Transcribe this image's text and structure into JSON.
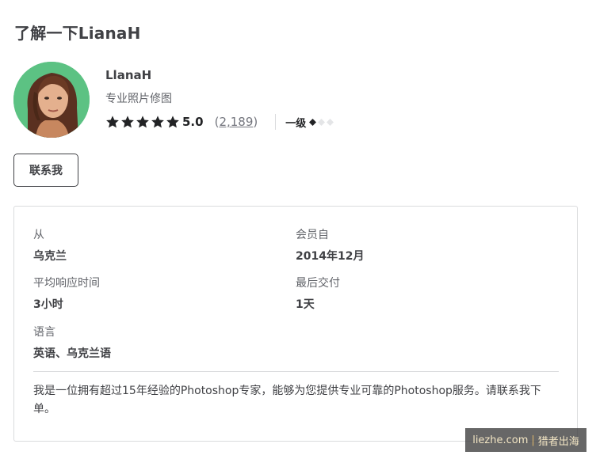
{
  "page": {
    "heading": "了解一下LianaH"
  },
  "seller": {
    "name": "LlanaH",
    "tagline": "专业照片修图",
    "rating": {
      "stars_filled": 5,
      "stars_total": 5,
      "score": "5.0",
      "review_open": "(",
      "review_count": "2,189",
      "review_close": ")"
    },
    "level": {
      "label": "一级",
      "diamonds_filled": 1,
      "diamonds_total": 3
    },
    "contact_button": "联系我",
    "avatar_bg": "#5cc283"
  },
  "stats": {
    "from_label": "从",
    "from_value": "乌克兰",
    "member_since_label": "会员自",
    "member_since_value": "2014年12月",
    "avg_response_label": "平均响应时间",
    "avg_response_value": "3小时",
    "last_delivery_label": "最后交付",
    "last_delivery_value": "1天",
    "languages_label": "语言",
    "languages_value": "英语、乌克兰语"
  },
  "description": "我是一位拥有超过15年经验的Photoshop专家，能够为您提供专业可靠的Photoshop服务。请联系我下单。",
  "watermark": {
    "site": "liezhe.com",
    "separator": "|",
    "brand": "猎者出海"
  },
  "colors": {
    "text": "#404145",
    "muted": "#62646a",
    "star": "#222325",
    "border": "#dadbdd"
  }
}
